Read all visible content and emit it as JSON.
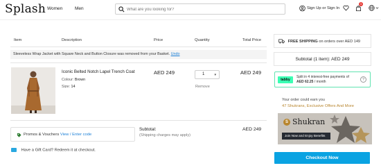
{
  "header": {
    "logo": "Splash",
    "nav": [
      "Women",
      "Men"
    ],
    "search_placeholder": "What are you looking for?",
    "signin_label": "Sign Up or Sign In",
    "cart_count": "1"
  },
  "table_headers": {
    "item": "Item",
    "description": "Description",
    "price": "Price",
    "quantity": "Quantity",
    "total": "Total Price"
  },
  "notice": {
    "text": "Sleeveless Wrap Jacket with Square Neck and Button Closure was removed from your Basket.",
    "undo": "Undo"
  },
  "cart_item": {
    "name": "Iconic Belted Notch Lapel Trench Coat",
    "colour_label": "Colour:",
    "colour": "Brown",
    "size_label": "Size:",
    "size": "14",
    "price": "AED 249",
    "quantity": "1",
    "total": "AED 249",
    "remove": "Remove"
  },
  "promo": {
    "label": "Promos & Vouchers",
    "link": "View / Enter code"
  },
  "subtotal": {
    "label": "Subtotal:",
    "note": "(Shipping charges may apply)",
    "value": "AED 249"
  },
  "gift": {
    "text": "Have a Gift Card? Redeem it at checkout."
  },
  "sidebar": {
    "shipping_bold": "FREE SHIPPING",
    "shipping_rest": "on orders over AED 149",
    "summary": "Subtotal (1 item):  AED 249",
    "tabby_logo": "tabby",
    "tabby_line1": "Split in 4 interest-free payments of",
    "tabby_amount": "AED 62.25",
    "tabby_suffix": "/ month",
    "tabby_info": "?",
    "shukran_line1": "Your order could earn you",
    "shukran_line2": "47 Shukrans, Exclusive Offers And More",
    "shukran_title": "Shukran",
    "shukran_button": "Join Now and Enjoy Benefits",
    "checkout": "Checkout Now"
  },
  "colors": {
    "accent": "#0aa3e2",
    "link": "#1b7fd6",
    "tabby_green": "#3bffb3",
    "shukran_gold": "#b8862e",
    "cart_badge": "#e53935"
  }
}
